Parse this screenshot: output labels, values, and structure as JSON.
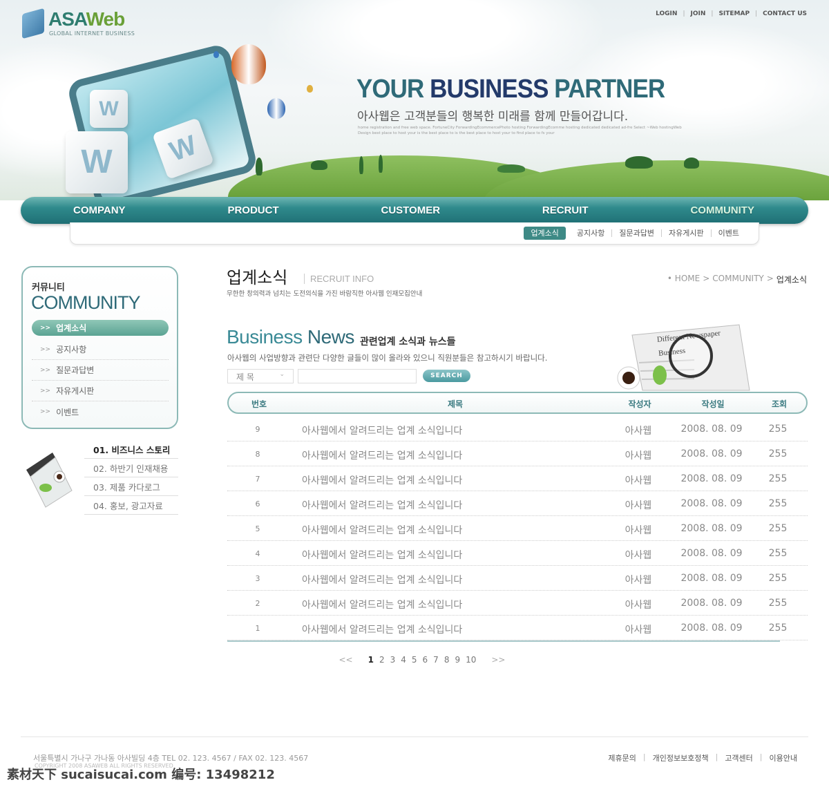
{
  "header": {
    "logo": "ASAWeb",
    "logo_main": "ASA",
    "logo_accent": "Web",
    "logo_sub": "GLOBAL INTERNET BUSINESS",
    "util_links": [
      "LOGIN",
      "JOIN",
      "SITEMAP",
      "CONTACT US"
    ],
    "headline_a": "YOUR ",
    "headline_b": "BUSINESS ",
    "headline_c": "PARTNER",
    "tagline": "아사웹은 고객분들의 행복한 미래를 함께 만들어갑니다.",
    "desc": "home registration and free web space. FortuneCity ForwardingEcommercePhoto hosting ForwardingEcomme hosting dedicated dedicated ad-fre Select ~Web hostingWeb Design best place to host your is the best place to is the best place to host your to find place to fs your"
  },
  "nav": {
    "main": [
      "COMPANY",
      "PRODUCT",
      "CUSTOMER",
      "RECRUIT",
      "COMMUNITY"
    ],
    "active_main": "COMMUNITY",
    "sub": [
      "업계소식",
      "공지사항",
      "질문과답변",
      "자유게시판",
      "이벤트"
    ],
    "active_sub": "업계소식"
  },
  "sidebar": {
    "title_kr": "커뮤니티",
    "title_en": "COMMUNITY",
    "arrow": ">>",
    "items": [
      "업계소식",
      "공지사항",
      "질문과답변",
      "자유게시판",
      "이벤트"
    ],
    "stories": [
      "01. 비즈니스 스토리",
      "02. 하반기 인재채용",
      "03. 제품 카다로그",
      "04. 홍보, 광고자료"
    ]
  },
  "page": {
    "title": "업계소식",
    "subtitle": "RECRUIT INFO",
    "desc": "무한한 창의력과 넘치는 도전의식을 가진 바람직한 아사웹 인재모집안내",
    "breadcrumb": [
      "• HOME",
      ">",
      "COMMUNITY",
      ">",
      "업계소식"
    ]
  },
  "board": {
    "title_a": "Business ",
    "title_b": "News",
    "title_kr": "관련업계 소식과 뉴스들",
    "desc": "아사웹의 사업방향과 관련단 다양한 글들이 많이 올라와 있으니 직원분들은 참고하시기 바랍니다.",
    "search_field": "제 목",
    "search_value": "",
    "search_button": "SEARCH",
    "columns": [
      "번호",
      "제목",
      "작성자",
      "작성일",
      "조회"
    ],
    "rows": [
      [
        "9",
        "아사웹에서 알려드리는 업계 소식입니다",
        "아사웹",
        "2008. 08. 09",
        "255"
      ],
      [
        "8",
        "아사웹에서 알려드리는 업계 소식입니다",
        "아사웹",
        "2008. 08. 09",
        "255"
      ],
      [
        "7",
        "아사웹에서 알려드리는 업계 소식입니다",
        "아사웹",
        "2008. 08. 09",
        "255"
      ],
      [
        "6",
        "아사웹에서 알려드리는 업계 소식입니다",
        "아사웹",
        "2008. 08. 09",
        "255"
      ],
      [
        "5",
        "아사웹에서 알려드리는 업계 소식입니다",
        "아사웹",
        "2008. 08. 09",
        "255"
      ],
      [
        "4",
        "아사웹에서 알려드리는 업계 소식입니다",
        "아사웹",
        "2008. 08. 09",
        "255"
      ],
      [
        "3",
        "아사웹에서 알려드리는 업계 소식입니다",
        "아사웹",
        "2008. 08. 09",
        "255"
      ],
      [
        "2",
        "아사웹에서 알려드리는 업계 소식입니다",
        "아사웹",
        "2008. 08. 09",
        "255"
      ],
      [
        "1",
        "아사웹에서 알려드리는 업계 소식입니다",
        "아사웹",
        "2008. 08. 09",
        "255"
      ]
    ],
    "pager": {
      "prev": "<<",
      "next": ">>",
      "pages": [
        "1",
        "2",
        "3",
        "4",
        "5",
        "6",
        "7",
        "8",
        "9",
        "10"
      ],
      "current": "1"
    },
    "newspaper_text": "Different Newspaper Business"
  },
  "footer": {
    "address": "서울특별시 가나구 가나동 아사빌딩 4층  TEL 02. 123. 4567 / FAX 02. 123. 4567",
    "copyright": "COPYRIGHT 2008 ASAWEB ALL RIGHTS RESERVED",
    "links": [
      "제휴문의",
      "개인정보보호정책",
      "고객센터",
      "이용안내"
    ]
  },
  "watermark": "素材天下 sucaisucai.com  编号: 13498212",
  "colors": {
    "accent": "#2f8a8c",
    "nav_dark": "#1f6f75",
    "title_teal": "#2f6a78"
  }
}
